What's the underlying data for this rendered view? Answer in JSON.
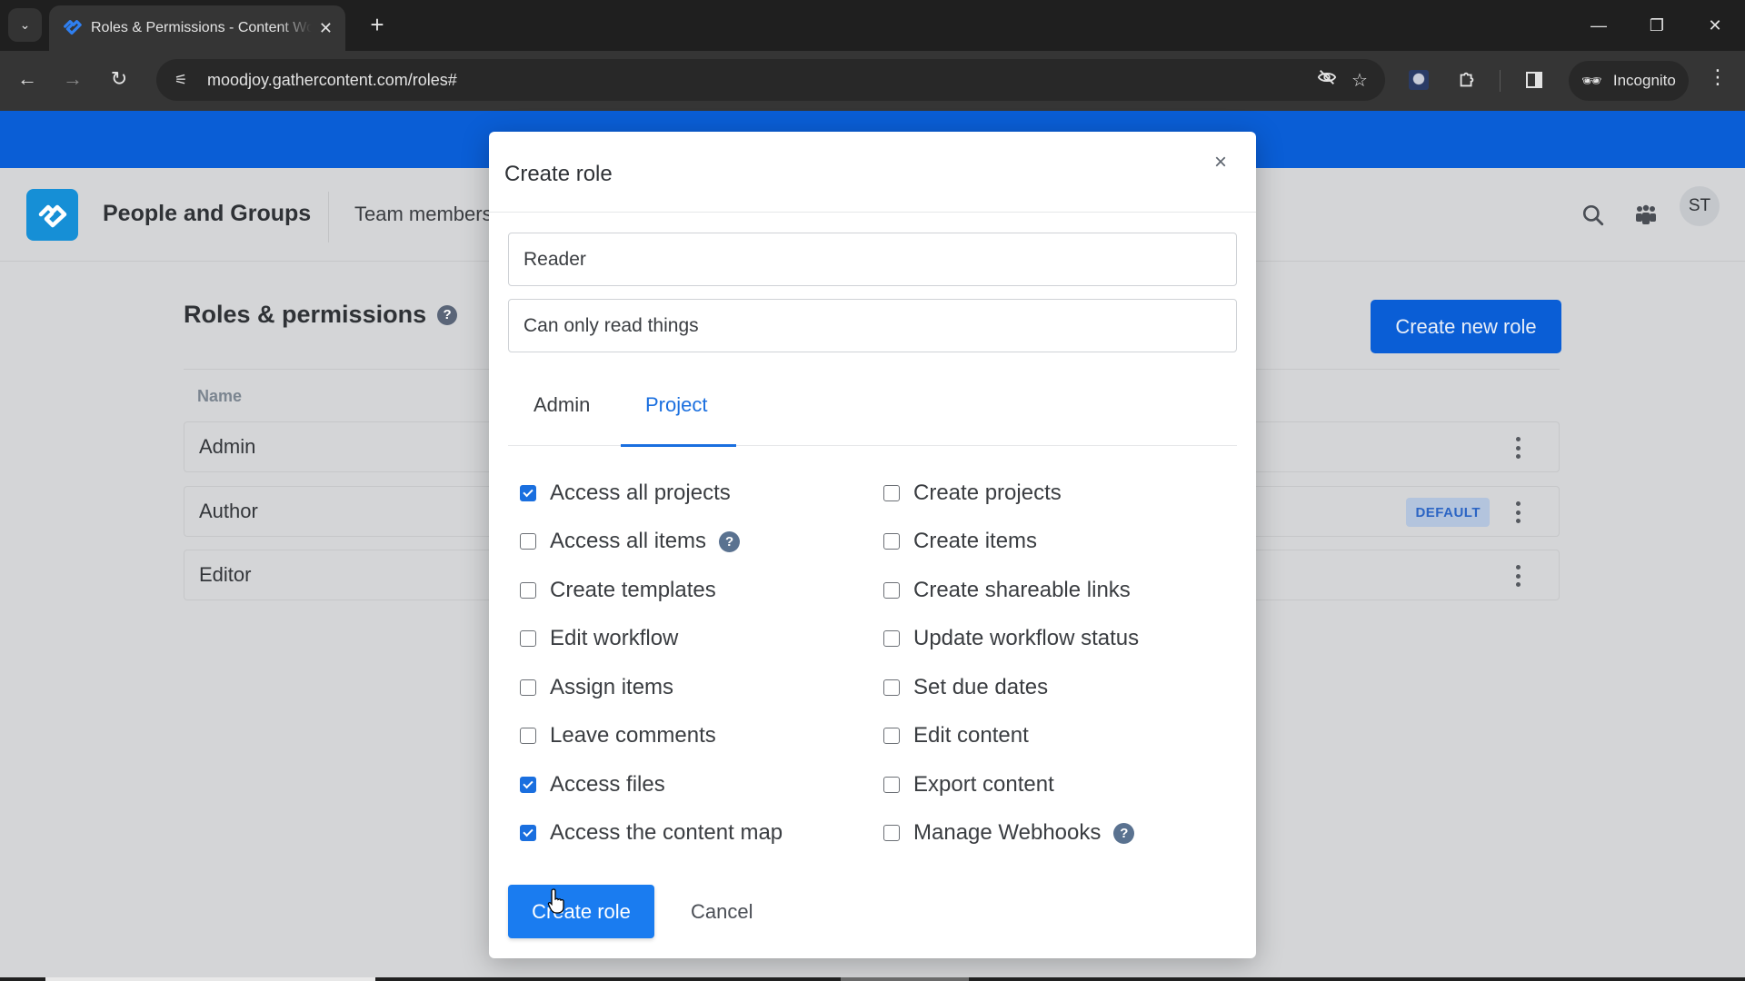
{
  "browser": {
    "tab_title": "Roles & Permissions - Content Workflow",
    "url": "moodjoy.gathercontent.com/roles#",
    "incognito_label": "Incognito",
    "icons": {
      "tab_search": "chevron-down-icon",
      "new_tab": "plus-icon",
      "back": "arrow-left-icon",
      "forward": "arrow-right-icon",
      "reload": "reload-icon",
      "site_info": "tune-icon",
      "eye_off": "eye-off-icon",
      "bookmark": "star-icon",
      "extensions": "puzzle-icon",
      "side_panel": "side-panel-icon",
      "menu": "kebab-icon"
    }
  },
  "app": {
    "section_title": "People and Groups",
    "nav_item": "Team members",
    "avatar_initials": "ST",
    "accent_color": "#0a5ed6"
  },
  "page": {
    "title": "Roles & permissions",
    "help_glyph": "?",
    "create_new_label": "Create new role",
    "table": {
      "column_name": "Name",
      "rows": [
        {
          "name": "Admin",
          "badge": null
        },
        {
          "name": "Author",
          "badge": "DEFAULT"
        },
        {
          "name": "Editor",
          "badge": null
        }
      ]
    }
  },
  "modal": {
    "title": "Create role",
    "close_glyph": "×",
    "name_value": "Reader",
    "description_value": "Can only read things",
    "tabs": [
      {
        "label": "Admin",
        "active": false
      },
      {
        "label": "Project",
        "active": true
      }
    ],
    "permissions_left": [
      {
        "label": "Access all projects",
        "checked": true,
        "help": false
      },
      {
        "label": "Access all items",
        "checked": false,
        "help": true
      },
      {
        "label": "Create templates",
        "checked": false,
        "help": false
      },
      {
        "label": "Edit workflow",
        "checked": false,
        "help": false
      },
      {
        "label": "Assign items",
        "checked": false,
        "help": false
      },
      {
        "label": "Leave comments",
        "checked": false,
        "help": false
      },
      {
        "label": "Access files",
        "checked": true,
        "help": false
      },
      {
        "label": "Access the content map",
        "checked": true,
        "help": false
      }
    ],
    "permissions_right": [
      {
        "label": "Create projects",
        "checked": false,
        "help": false
      },
      {
        "label": "Create items",
        "checked": false,
        "help": false
      },
      {
        "label": "Create shareable links",
        "checked": false,
        "help": false
      },
      {
        "label": "Update workflow status",
        "checked": false,
        "help": false
      },
      {
        "label": "Set due dates",
        "checked": false,
        "help": false
      },
      {
        "label": "Edit content",
        "checked": false,
        "help": false
      },
      {
        "label": "Export content",
        "checked": false,
        "help": false
      },
      {
        "label": "Manage Webhooks",
        "checked": false,
        "help": true
      }
    ],
    "submit_label": "Create role",
    "cancel_label": "Cancel"
  }
}
